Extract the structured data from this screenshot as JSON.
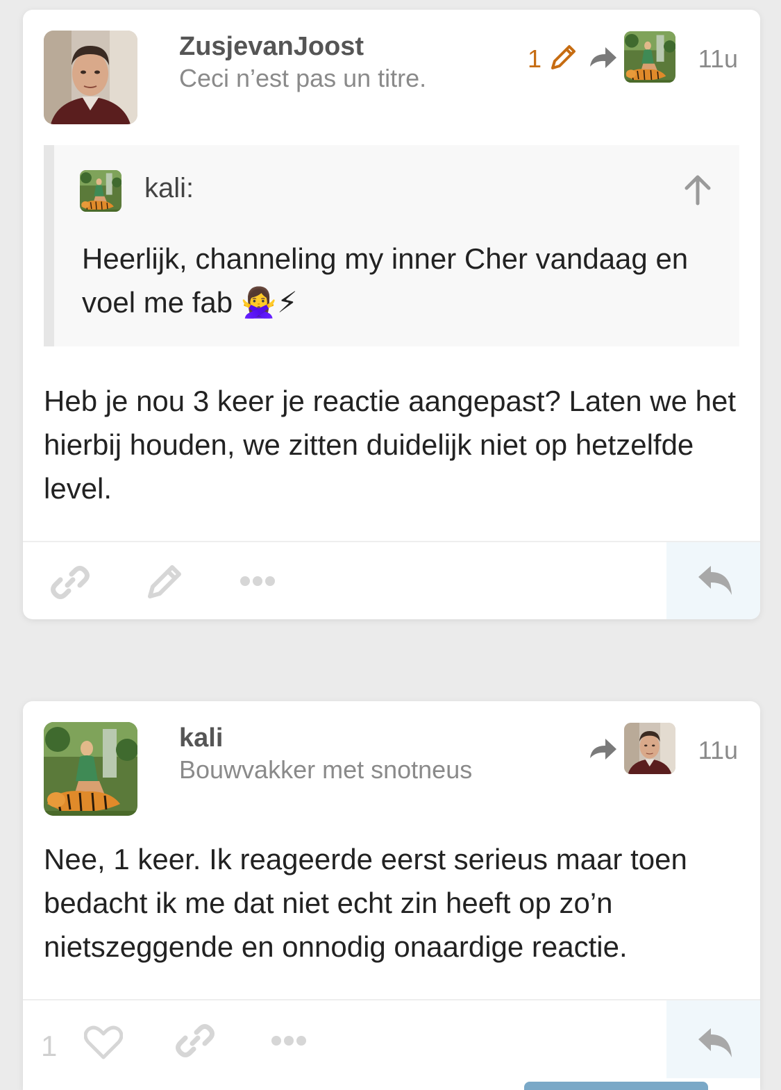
{
  "posts": [
    {
      "username": "ZusjevanJoost",
      "user_title": "Ceci n’est pas un titre.",
      "edit_count": "1",
      "time": "11u",
      "avatar_icon": "man-portrait-avatar",
      "reply_to_avatar_icon": "tiger-painting-avatar",
      "quote": {
        "author": "kali:",
        "text": "Heerlijk, channeling my inner Cher vandaag en voel me fab 🙅‍♀️⚡"
      },
      "body": "Heb je nou 3 keer je reactie aangepast? Laten we het hierbij houden, we zitten duidelijk niet op hetzelfde level.",
      "actions": [
        "link-icon",
        "pencil-icon",
        "more-icon",
        "reply-icon"
      ]
    },
    {
      "username": "kali",
      "user_title": "Bouwvakker met snotneus",
      "time": "11u",
      "avatar_icon": "tiger-painting-avatar",
      "reply_to_avatar_icon": "man-portrait-avatar",
      "body": "Nee, 1 keer. Ik reageerde eerst serieus maar toen bedacht ik me dat niet echt zin heeft op zo’n nietszeggende en onnodig onaardige reactie.",
      "like_count": "1",
      "actions": [
        "heart-icon",
        "link-icon",
        "more-icon",
        "reply-icon"
      ]
    }
  ],
  "colors": {
    "background": "#ebebeb",
    "edit_accent": "#c66c12",
    "reply_highlight": "#f0f7fb",
    "muted_icon": "#d6d6d6"
  }
}
